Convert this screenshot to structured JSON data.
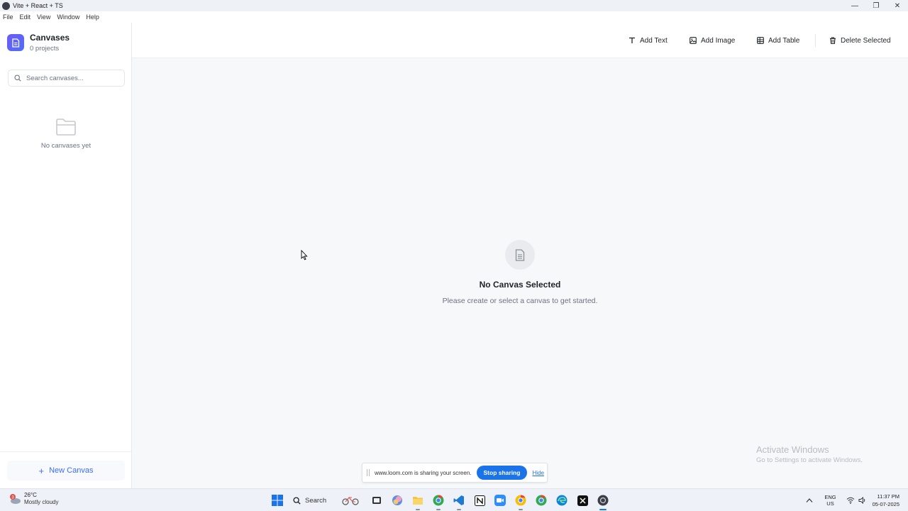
{
  "window": {
    "title": "Vite + React + TS",
    "minimize": "—",
    "maximize": "❐",
    "close": "✕"
  },
  "menu": [
    "File",
    "Edit",
    "View",
    "Window",
    "Help"
  ],
  "sidebar": {
    "title": "Canvases",
    "count": "0 projects",
    "search_placeholder": "Search canvases...",
    "empty_text": "No canvases yet",
    "new_canvas": "New Canvas"
  },
  "toolbar": {
    "add_text": "Add Text",
    "add_image": "Add Image",
    "add_table": "Add Table",
    "delete_selected": "Delete Selected"
  },
  "main": {
    "empty_title": "No Canvas Selected",
    "empty_subtitle": "Please create or select a canvas to get started."
  },
  "watermark": {
    "line1": "Activate Windows",
    "line2": "Go to Settings to activate Windows."
  },
  "loom": {
    "message": "www.loom.com is sharing your screen.",
    "stop": "Stop sharing",
    "hide": "Hide"
  },
  "taskbar": {
    "weather_badge": "3",
    "temperature": "26°C",
    "condition": "Mostly cloudy",
    "search_label": "Search",
    "lang_line1": "ENG",
    "lang_line2": "US",
    "time": "11:37 PM",
    "date": "05-07-2025"
  },
  "colors": {
    "accent": "#3b6ef5",
    "logo_start": "#6d5cf6",
    "logo_end": "#4f6ef7",
    "loom_blue": "#1a73e8"
  }
}
